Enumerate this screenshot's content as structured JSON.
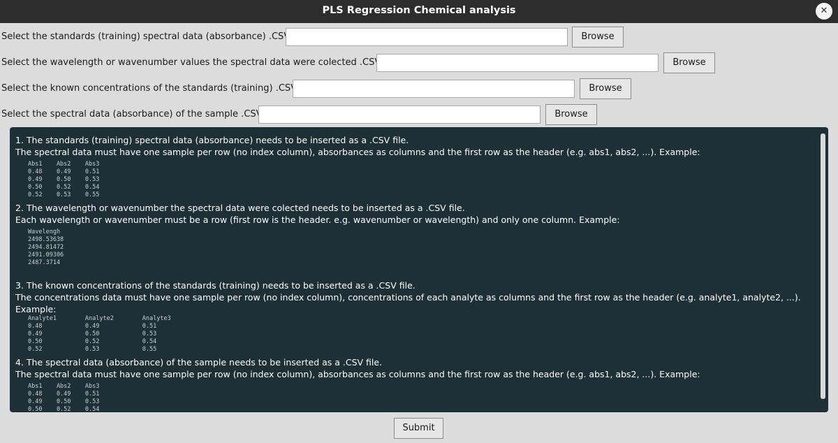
{
  "window": {
    "title": "PLS Regression Chemical analysis",
    "close_glyph": "✕"
  },
  "form": {
    "rows": [
      {
        "label": "Select the standards (training) spectral data (absorbance) .CSV:",
        "value": "",
        "button": "Browse"
      },
      {
        "label": "Select the wavelength or wavenumber values the spectral data were colected .CSV:",
        "value": "",
        "button": "Browse"
      },
      {
        "label": "Select the known concentrations of the standards (training) .CSV:",
        "value": "",
        "button": "Browse"
      },
      {
        "label": "Select the spectral data (absorbance) of the sample .CSV:",
        "value": "",
        "button": "Browse"
      }
    ]
  },
  "info": {
    "s1": {
      "title": "1. The standards (training) spectral data (absorbance) needs to be inserted as a .CSV file.",
      "desc": "The spectral data must have one sample per row (no index column), absorbances as columns and the first row as the header (e.g. abs1, abs2, ...). Example:",
      "example": "Abs1    Abs2    Abs3\n0.48    0.49    0.51\n0.49    0.50    0.53\n0.50    0.52    0.54\n0.52    0.53    0.55"
    },
    "s2": {
      "title": "2. The wavelength or wavenumber the spectral data were colected needs to be inserted as a .CSV file.",
      "desc": "Each wavelength or wavenumber must be a row (first row is the header. e.g. wavenumber or wavelength) and only one column. Example:",
      "example": "Wavelengh\n2498.53638\n2494.81472\n2491.09306\n2487.3714"
    },
    "s3": {
      "title": "3. The known concentrations of the standards (training) needs to be inserted as a .CSV file.",
      "desc": "The concentrations data must have one sample per row (no index column), concentrations of each analyte as columns and the first row as the header (e.g. analyte1, analyte2, ...).",
      "desc2": "Example:",
      "example": "Analyte1        Analyte2        Analyte3\n0.48            0.49            0.51\n0.49            0.50            0.53\n0.50            0.52            0.54\n0.52            0.53            0.55"
    },
    "s4": {
      "title": "4. The spectral data (absorbance) of the sample needs to be inserted as a .CSV file.",
      "desc": "The spectral data must have one sample per row (no index column), absorbances as columns and the first row as the header (e.g. abs1, abs2, ...). Example:",
      "example": "Abs1    Abs2    Abs3\n0.48    0.49    0.51\n0.49    0.50    0.53\n0.50    0.52    0.54"
    }
  },
  "submit_label": "Submit"
}
